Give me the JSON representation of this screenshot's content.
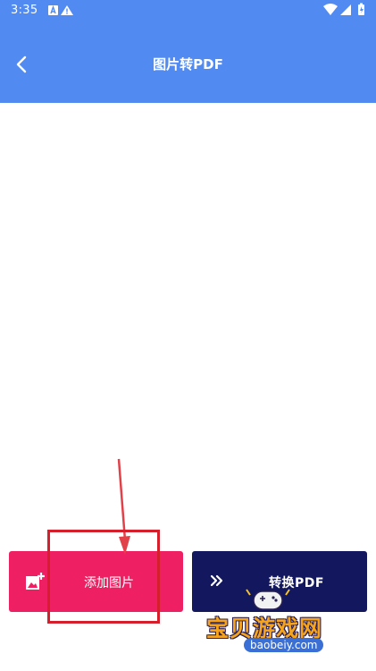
{
  "status_bar": {
    "time": "3:35",
    "icons": [
      "a-icon",
      "warning-icon",
      "wifi-icon",
      "signal-icon",
      "battery-icon"
    ]
  },
  "header": {
    "title": "图片转PDF",
    "back_icon": "back-icon"
  },
  "actions": {
    "add_image": {
      "label": "添加图片",
      "icon": "add-photo-icon",
      "color": "#ef1f63"
    },
    "convert": {
      "label": "转换PDF",
      "icon": "double-chevron-right-icon",
      "color": "#13185e"
    }
  },
  "watermark": {
    "text": "宝贝游戏网",
    "url": "baobeiy.com"
  },
  "colors": {
    "header": "#518bf2",
    "annotation": "#d61f2c"
  }
}
